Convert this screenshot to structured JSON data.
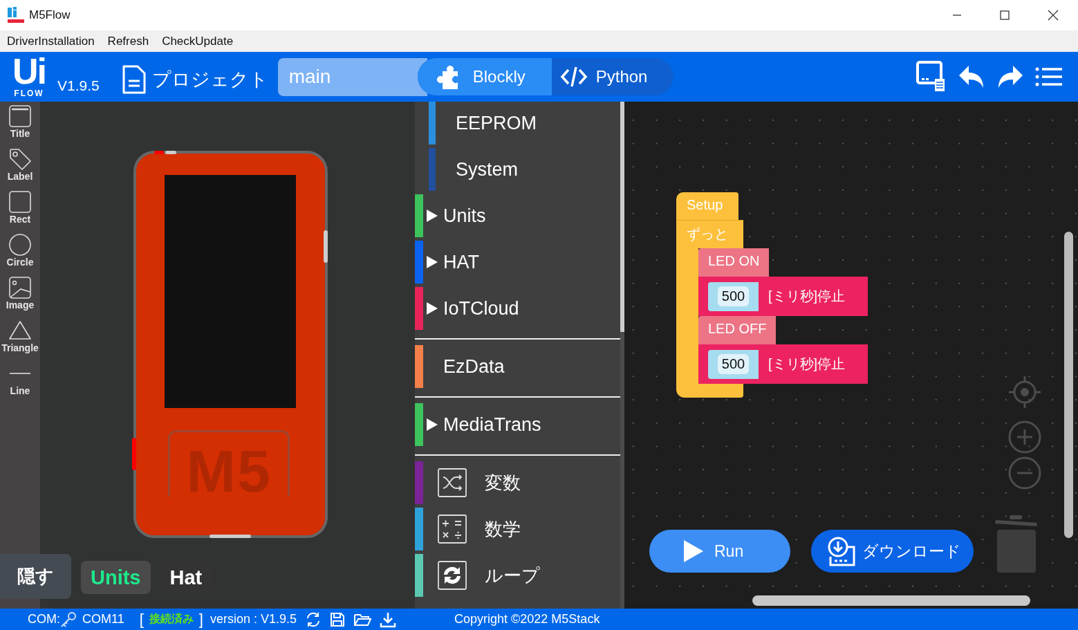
{
  "window": {
    "title": "M5Flow"
  },
  "menu": [
    "DriverInstallation",
    "Refresh",
    "CheckUpdate"
  ],
  "header": {
    "logo": {
      "main": "Ui",
      "sub": "FLOW"
    },
    "version": "V1.9.5",
    "project_label": "プロジェクト",
    "file_name": "main",
    "tabs": [
      {
        "label": "Blockly",
        "selected": true
      },
      {
        "label": "Python",
        "selected": false
      }
    ]
  },
  "tools": [
    "Title",
    "Label",
    "Rect",
    "Circle",
    "Image",
    "Triangle",
    "Line"
  ],
  "device": {
    "label": "M5"
  },
  "hide_button": "隠す",
  "panel_tabs": [
    {
      "label": "Units",
      "selected": true
    },
    {
      "label": "Hat",
      "selected": false
    }
  ],
  "categories": [
    {
      "kind": "sub",
      "label": "EEPROM",
      "color": "#2b8fde"
    },
    {
      "kind": "sub",
      "label": "System",
      "color": "#22509f"
    },
    {
      "kind": "folder",
      "label": "Units",
      "color": "#3cc35c",
      "expanded": false
    },
    {
      "kind": "folder",
      "label": "HAT",
      "color": "#0b63f0",
      "expanded": false
    },
    {
      "kind": "folder",
      "label": "IoTCloud",
      "color": "#e8245a",
      "expanded": false
    },
    {
      "kind": "separator"
    },
    {
      "kind": "top",
      "label": "EzData",
      "color": "#f3804a"
    },
    {
      "kind": "separator"
    },
    {
      "kind": "folder",
      "label": "MediaTrans",
      "color": "#3cc35c",
      "expanded": false
    },
    {
      "kind": "separator"
    },
    {
      "kind": "variables",
      "label": "変数",
      "color": "#7b2397"
    },
    {
      "kind": "math",
      "label": "数学",
      "color": "#2ea3db"
    },
    {
      "kind": "loop",
      "label": "ループ",
      "color": "#5cc8b2"
    }
  ],
  "blocks": {
    "setup": "Setup",
    "loop": "ずっと",
    "statements": [
      {
        "kind": "led",
        "label": "LED ON"
      },
      {
        "kind": "wait",
        "value": "500",
        "label": "[ミリ秒]停止"
      },
      {
        "kind": "led",
        "label": "LED OFF"
      },
      {
        "kind": "wait",
        "value": "500",
        "label": "[ミリ秒]停止"
      }
    ]
  },
  "actions": {
    "run": "Run",
    "download": "ダウンロード"
  },
  "status_bar": {
    "com_label": "COM:",
    "port": "COM11",
    "open_bracket": "[",
    "connection": "接続済み",
    "close_bracket": "]",
    "version": "version : V1.9.5",
    "copyright": "Copyright ©2022 M5Stack"
  }
}
